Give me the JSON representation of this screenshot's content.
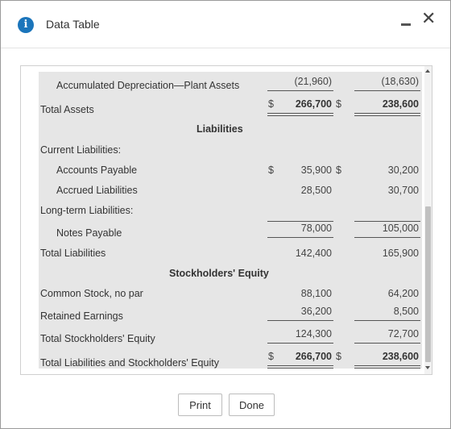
{
  "window": {
    "title": "Data Table",
    "info_icon": "i"
  },
  "table": {
    "rows": {
      "accum_dep": {
        "label": "Accumulated Depreciation—Plant Assets",
        "col1": "(21,960)",
        "col2": "(18,630)"
      },
      "total_assets": {
        "label": "Total Assets",
        "dollar1": "$",
        "col1": "266,700",
        "dollar2": "$",
        "col2": "238,600"
      },
      "liabilities_header": "Liabilities",
      "current_liabilities": "Current Liabilities:",
      "accounts_payable": {
        "label": "Accounts Payable",
        "dollar1": "$",
        "col1": "35,900",
        "dollar2": "$",
        "col2": "30,200"
      },
      "accrued_liabilities": {
        "label": "Accrued Liabilities",
        "col1": "28,500",
        "col2": "30,700"
      },
      "long_term_liabilities": "Long-term Liabilities:",
      "notes_payable": {
        "label": "Notes Payable",
        "col1": "78,000",
        "col2": "105,000"
      },
      "total_liabilities": {
        "label": "Total Liabilities",
        "col1": "142,400",
        "col2": "165,900"
      },
      "equity_header": "Stockholders' Equity",
      "common_stock": {
        "label": "Common Stock, no par",
        "col1": "88,100",
        "col2": "64,200"
      },
      "retained_earnings": {
        "label": "Retained Earnings",
        "col1": "36,200",
        "col2": "8,500"
      },
      "total_equity": {
        "label": "Total Stockholders' Equity",
        "col1": "124,300",
        "col2": "72,700"
      },
      "total_liab_equity": {
        "label": "Total Liabilities and Stockholders' Equity",
        "dollar1": "$",
        "col1": "266,700",
        "dollar2": "$",
        "col2": "238,600"
      }
    }
  },
  "buttons": {
    "print": "Print",
    "done": "Done"
  }
}
